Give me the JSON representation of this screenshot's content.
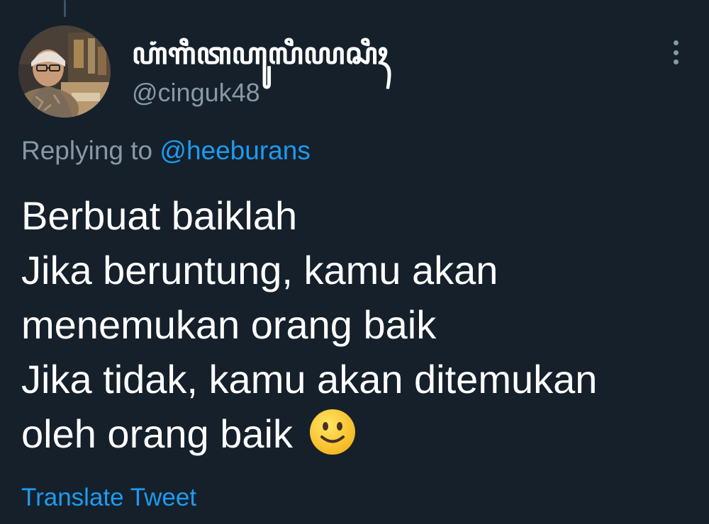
{
  "tweet": {
    "display_name": "ꦲꦁꦒꦶꦠꦲꦸꦭꦶꦪꦱꦶꦃ",
    "handle": "@cinguk48",
    "replying_prefix": "Replying to ",
    "replying_to": "@heeburans",
    "body_lines": [
      "Berbuat baiklah",
      "Jika beruntung, kamu akan",
      "menemukan orang baik",
      "Jika tidak, kamu akan ditemukan",
      "oleh orang baik"
    ],
    "emoji": "slightly-smiling-face",
    "translate_label": "Translate Tweet"
  },
  "icons": {
    "more": "more-vertical-icon"
  },
  "colors": {
    "background": "#15202b",
    "primary_text": "#ffffff",
    "secondary_text": "#8899a6",
    "accent": "#1d9bf0"
  }
}
